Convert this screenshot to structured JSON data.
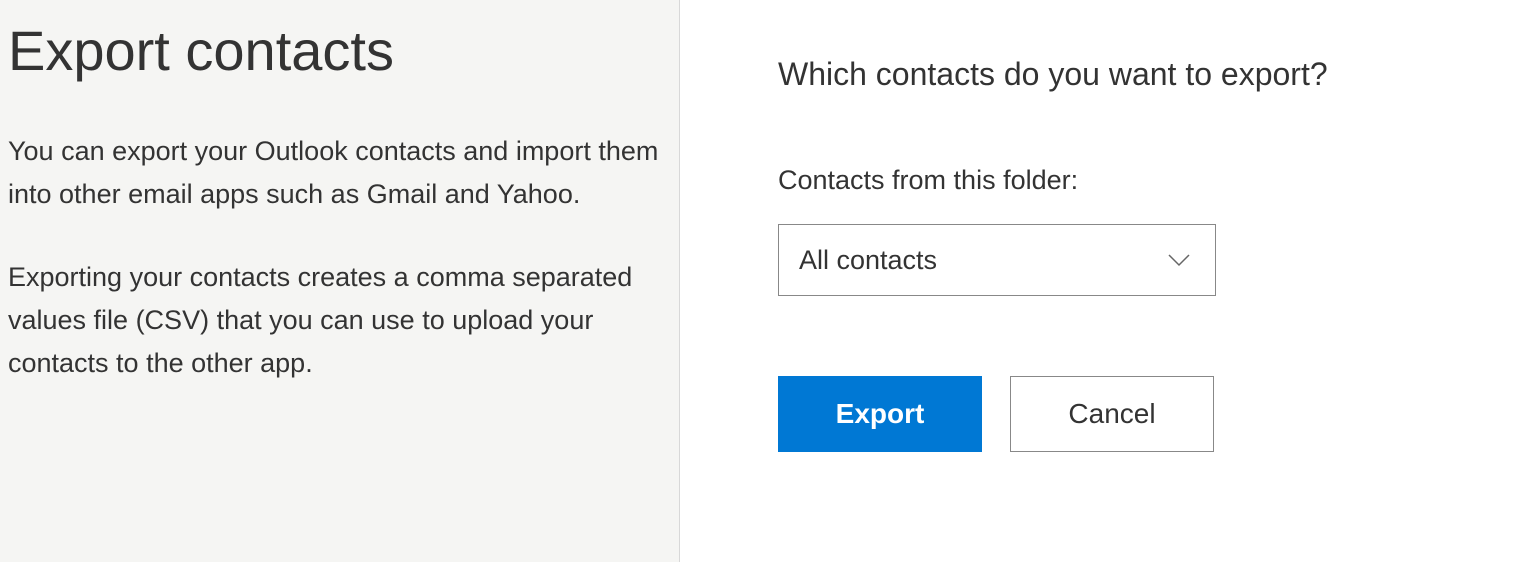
{
  "left": {
    "title": "Export contacts",
    "desc1": "You can export your Outlook contacts and import them into other email apps such as Gmail and Yahoo.",
    "desc2": "Exporting your contacts creates a comma separated values file (CSV) that you can use to upload your contacts to the other app."
  },
  "right": {
    "heading": "Which contacts do you want to export?",
    "field_label": "Contacts from this folder:",
    "dropdown_selected": "All contacts",
    "export_label": "Export",
    "cancel_label": "Cancel"
  }
}
